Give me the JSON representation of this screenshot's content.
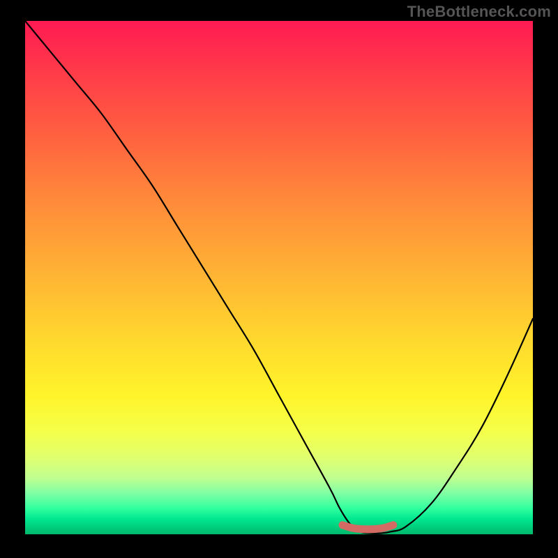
{
  "watermark": "TheBottleneck.com",
  "chart_data": {
    "type": "line",
    "title": "",
    "xlabel": "",
    "ylabel": "",
    "xlim": [
      0,
      100
    ],
    "ylim": [
      0,
      100
    ],
    "grid": false,
    "series": [
      {
        "name": "curve",
        "color": "#000000",
        "x": [
          0,
          5,
          10,
          15,
          20,
          25,
          30,
          35,
          40,
          45,
          50,
          55,
          60,
          62,
          64,
          66,
          68,
          70,
          72,
          75,
          80,
          85,
          90,
          95,
          100
        ],
        "values": [
          100,
          94,
          88,
          82,
          75,
          68,
          60,
          52,
          44,
          36,
          27,
          18,
          9,
          5,
          2,
          0.5,
          0.2,
          0.2,
          0.5,
          1.5,
          6,
          13,
          21,
          31,
          42
        ]
      },
      {
        "name": "optimal-range-marker",
        "color": "#d36a63",
        "x": [
          62.5,
          64.5,
          66.5,
          68.5,
          70.5,
          72.5
        ],
        "values": [
          1.8,
          1.2,
          1.0,
          1.0,
          1.2,
          1.8
        ]
      }
    ],
    "annotations": []
  }
}
